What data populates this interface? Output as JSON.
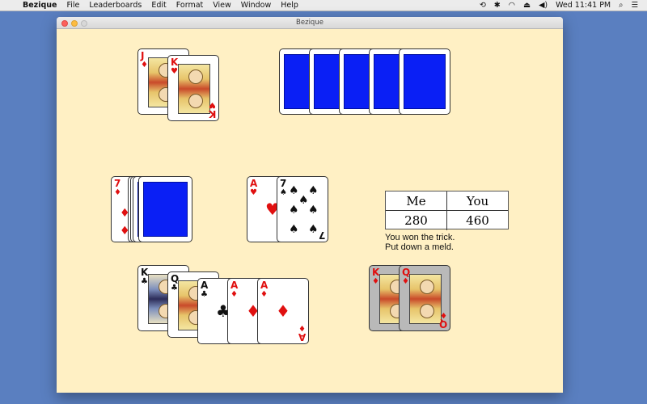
{
  "menubar": {
    "app_name": "Bezique",
    "menus": [
      "File",
      "Leaderboards",
      "Edit",
      "Format",
      "View",
      "Window",
      "Help"
    ],
    "clock": "Wed 11:41 PM"
  },
  "window": {
    "title": "Bezique"
  },
  "score": {
    "me_label": "Me",
    "you_label": "You",
    "me_value": "280",
    "you_value": "460"
  },
  "message": {
    "line1": "You won the trick.",
    "line2": "Put down a meld."
  },
  "cards": {
    "opponent_meld": [
      {
        "rank": "J",
        "suit": "♦",
        "color": "red"
      },
      {
        "rank": "K",
        "suit": "♥",
        "color": "red"
      }
    ],
    "opponent_hand_count": 5,
    "stock": {
      "trump_rank": "7",
      "trump_suit": "♦",
      "trump_color": "red"
    },
    "trick": [
      {
        "rank": "A",
        "suit": "♥",
        "color": "red"
      },
      {
        "rank": "7",
        "suit": "♠",
        "color": "black"
      }
    ],
    "player_hand": [
      {
        "rank": "K",
        "suit": "♣",
        "color": "black"
      },
      {
        "rank": "Q",
        "suit": "♣",
        "color": "black"
      },
      {
        "rank": "A",
        "suit": "♣",
        "color": "black"
      },
      {
        "rank": "A",
        "suit": "♦",
        "color": "red"
      },
      {
        "rank": "A",
        "suit": "♦",
        "color": "red"
      }
    ],
    "player_meld": [
      {
        "rank": "K",
        "suit": "♦",
        "color": "red"
      },
      {
        "rank": "Q",
        "suit": "♦",
        "color": "red"
      }
    ]
  },
  "colors": {
    "table": "#fff0c4",
    "card_back": "#0a1ff5",
    "desktop": "#5a7fc0"
  }
}
